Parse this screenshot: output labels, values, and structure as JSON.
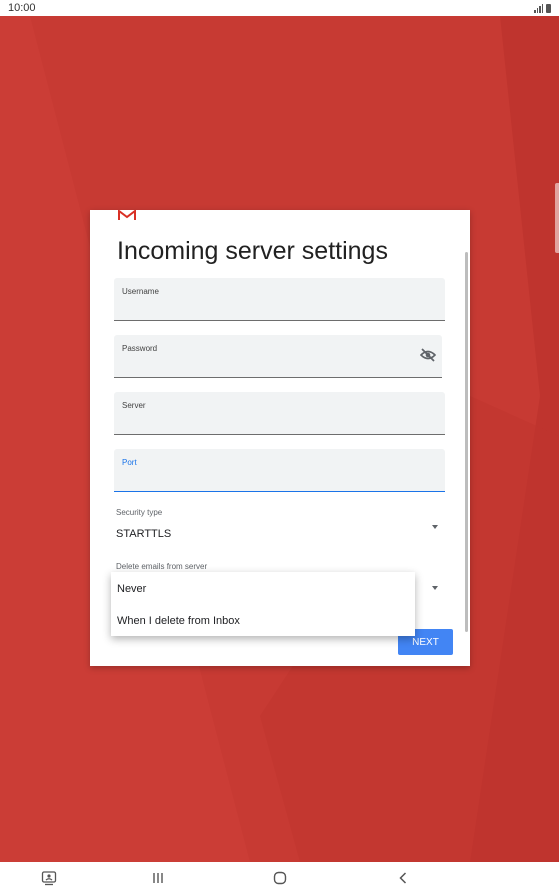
{
  "status_bar": {
    "time": "10:00",
    "icons": [
      "signal-icon",
      "battery-icon"
    ]
  },
  "dialog": {
    "logo": "gmail-logo",
    "title": "Incoming server settings",
    "fields": {
      "username": {
        "label": "Username",
        "value": ""
      },
      "password": {
        "label": "Password",
        "value": "",
        "toggle_icon": "visibility-off-icon"
      },
      "server": {
        "label": "Server",
        "value": ""
      },
      "port": {
        "label": "Port",
        "value": "",
        "focused": true
      }
    },
    "security_type": {
      "label": "Security type",
      "value": "STARTTLS"
    },
    "delete_emails": {
      "label": "Delete emails from server"
    },
    "next_label": "NEXT"
  },
  "dropdown": {
    "options": [
      "Never",
      "When I delete from Inbox"
    ]
  },
  "nav_bar": {
    "buttons": [
      "screenshot-icon",
      "recents-icon",
      "home-icon",
      "back-icon"
    ]
  },
  "colors": {
    "background": "#c73a33",
    "accent": "#4285f4",
    "focus": "#1a73e8"
  }
}
